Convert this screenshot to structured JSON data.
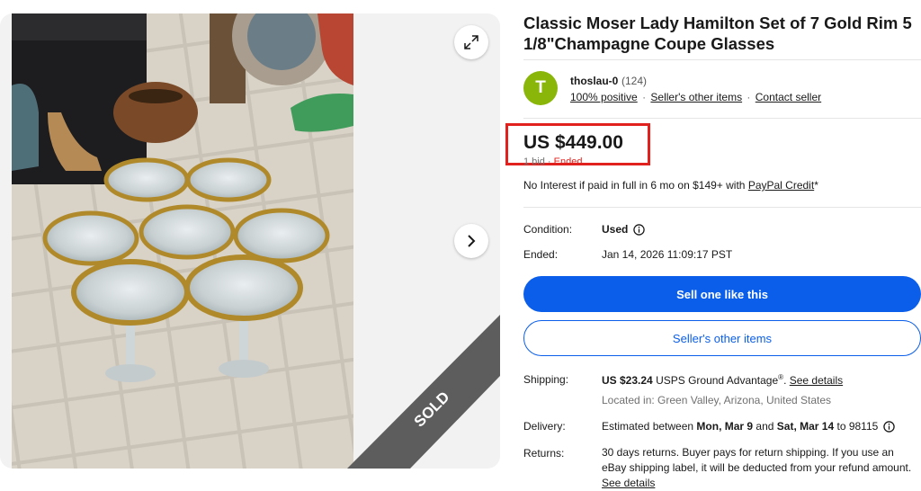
{
  "listing": {
    "title": "Classic Moser Lady Hamilton Set of 7 Gold Rim 5 1/8\"Champagne Coupe Glasses",
    "sold_ribbon": "SOLD"
  },
  "seller": {
    "avatar_letter": "T",
    "name": "thoslau-0",
    "feedback_count": "(124)",
    "positive": "100% positive",
    "other_items_link": "Seller's other items",
    "contact_link": "Contact seller",
    "separator": "·"
  },
  "price": {
    "amount": "US $449.00",
    "bids": "1 bid",
    "status": "Ended",
    "highlight_color": "#e0211d"
  },
  "financing": {
    "text": "No Interest if paid in full in 6 mo on $149+ with ",
    "link": "PayPal Credit",
    "suffix": "*"
  },
  "condition": {
    "label": "Condition:",
    "value": "Used"
  },
  "ended": {
    "label": "Ended:",
    "value": "Jan 14, 2026 11:09:17 PST"
  },
  "actions": {
    "sell_one": "Sell one like this",
    "sellers_other_items": "Seller's other items"
  },
  "shipping": {
    "label": "Shipping:",
    "cost": "US $23.24",
    "method": "USPS Ground Advantage",
    "reg": "®",
    "dot": ".",
    "details_link": "See details",
    "location": "Located in: Green Valley, Arizona, United States"
  },
  "delivery": {
    "label": "Delivery:",
    "prefix": "Estimated between ",
    "start": "Mon, Mar 9",
    "and": " and ",
    "end": "Sat, Mar 14",
    "suffix": " to 98115"
  },
  "returns": {
    "label": "Returns:",
    "text": "30 days returns. Buyer pays for return shipping. If you use an eBay shipping label, it will be deducted from your refund amount.",
    "details_link": "See details"
  },
  "colors": {
    "primary_blue": "#0a5eea",
    "avatar_green": "#8ab60a"
  }
}
